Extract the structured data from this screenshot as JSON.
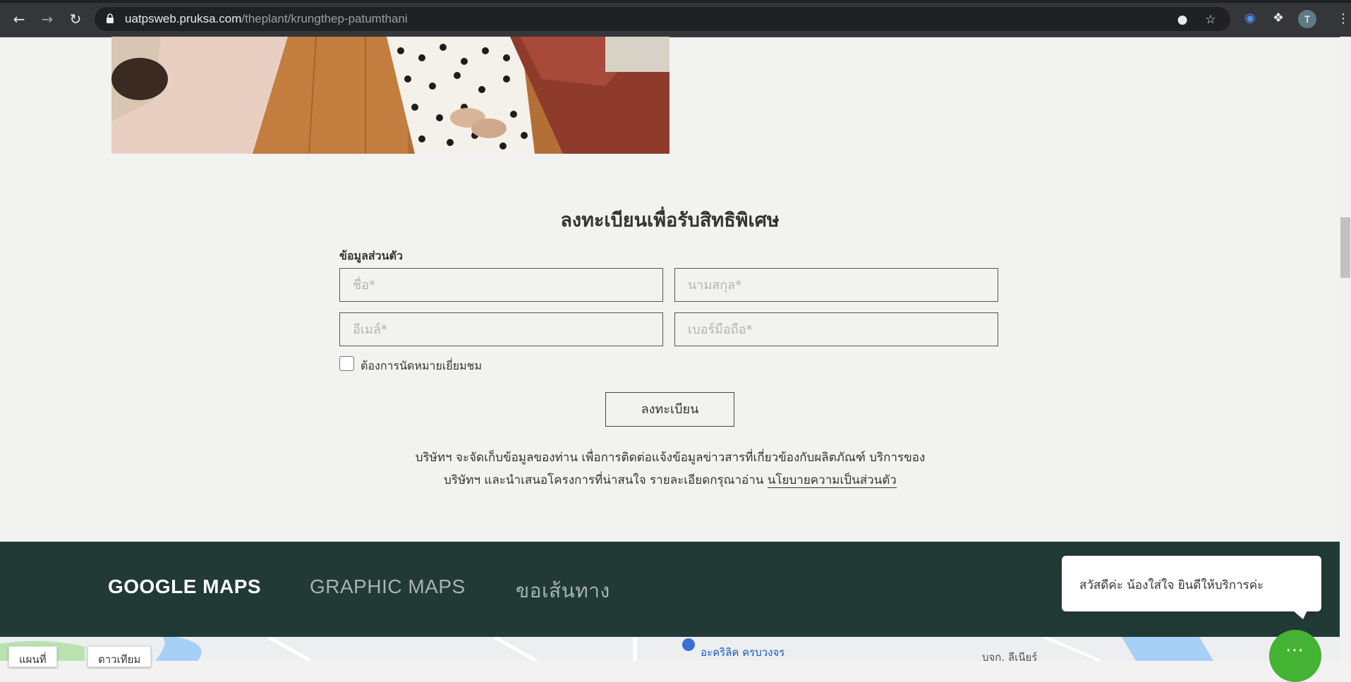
{
  "browser": {
    "url_host": "uatpsweb.pruksa.com",
    "url_path": "/theplant/krungthep-patumthani",
    "profile_initial": "T"
  },
  "registration": {
    "title": "ลงทะเบียนเพื่อรับสิทธิพิเศษ",
    "section_label": "ข้อมูลส่วนตัว",
    "first_name_placeholder": "ชื่อ*",
    "last_name_placeholder": "นามสกุล*",
    "email_placeholder": "อีเมล์*",
    "phone_placeholder": "เบอร์มือถือ*",
    "appointment_checkbox_label": "ต้องการนัดหมายเยี่ยมชม",
    "submit_label": "ลงทะเบียน",
    "disclaimer_line1": "บริษัทฯ จะจัดเก็บข้อมูลของท่าน เพื่อการติดต่อแจ้งข้อมูลข่าวสารที่เกี่ยวข้องกับผลิตภัณฑ์ บริการของ",
    "disclaimer_line2": "บริษัทฯ และนำเสนอโครงการที่น่าสนใจ รายละเอียดกรุณาอ่าน",
    "policy_link": "นโยบายความเป็นส่วนตัว"
  },
  "map_tabs": [
    {
      "label": "GOOGLE MAPS",
      "active": true
    },
    {
      "label": "GRAPHIC MAPS",
      "active": false
    },
    {
      "label": "ขอเส้นทาง",
      "active": false
    }
  ],
  "map": {
    "btn_map": "แผนที่",
    "btn_satellite": "ดาวเทียม",
    "place1": "อะคริลิค ครบวงจร",
    "place2": "บจก. ลีเนียร์"
  },
  "chat": {
    "greeting": "สวัสดีค่ะ น้องใส่ใจ ยินดีให้บริการค่ะ"
  },
  "colors": {
    "page_bg": "#f2f2f0",
    "map_band": "#223a36",
    "chat_green": "#44b232"
  }
}
